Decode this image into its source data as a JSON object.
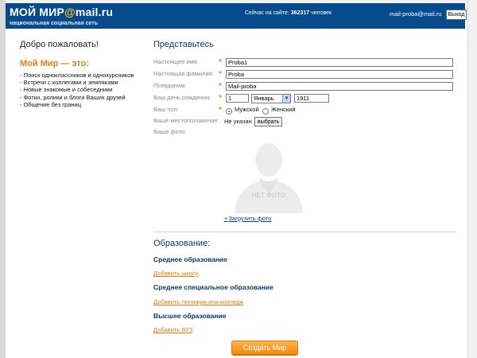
{
  "header": {
    "logo_text": "МОЙ МИР@mail.ru",
    "logo_part1": "МОЙ МИР",
    "logo_part2": "@",
    "logo_part3": "mail.ru",
    "subtitle": "национальная социальная сеть",
    "online_prefix": "Сейчас на сайте:",
    "online_count": "362317",
    "online_suffix": "человек",
    "user_email": "mail-proba@mail.ru",
    "logout_label": "Выход"
  },
  "sidebar": {
    "welcome": "Добро пожаловать!",
    "about_title": "Мой Мир — это:",
    "items": [
      "Поиск одноклассников и однокурсников",
      "Встречи с коллегами и земляками",
      "Новые знакомые и собеседники",
      "Фотки, ролики и блоги Ваших друзей",
      "Общение без границ"
    ]
  },
  "form": {
    "title": "Представьтесь",
    "required_mark": "*",
    "first_name": {
      "label": "Настоящее имя:",
      "value": "Proba1"
    },
    "last_name": {
      "label": "Настоящая фамилия:",
      "value": "Proba"
    },
    "nickname": {
      "label": "Псевдоним:",
      "value": "Mail-proba"
    },
    "birthday": {
      "label": "Ваш день рождения:",
      "day": "1",
      "month": "Январь",
      "year": "1911"
    },
    "gender": {
      "label": "Ваш пол:",
      "male": "Мужской",
      "female": "Женский",
      "selected": "male"
    },
    "location": {
      "label": "Ваше местоположение:",
      "value": "Не указан",
      "button": "выбрать"
    },
    "photo": {
      "label": "Ваше фото:",
      "placeholder_text": "НЕТ ФОТО",
      "upload_icon": "plus-icon",
      "upload_link": "Загрузить фото"
    }
  },
  "education": {
    "title": "Образование:",
    "secondary": {
      "title": "Среднее образование",
      "link": "Добавить школу"
    },
    "vocational": {
      "title": "Среднее специальное образование",
      "link": "Добавить техникум или колледж"
    },
    "higher": {
      "title": "Высшее образование",
      "link": "Добавить ВУЗ"
    }
  },
  "submit_label": "Создать Мир",
  "colors": {
    "header_bg": "#064b8c",
    "accent_orange": "#e87c14",
    "section_blue": "#0a3a66"
  }
}
